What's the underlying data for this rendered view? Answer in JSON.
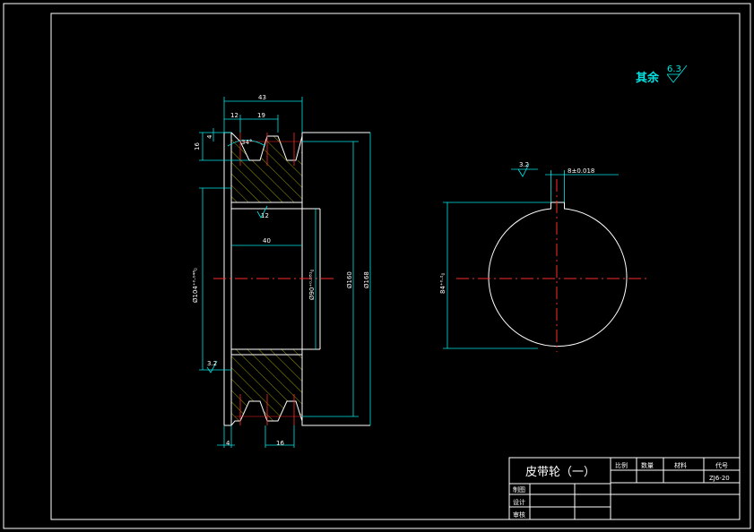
{
  "roughness": {
    "label": "其余",
    "value": "6.3"
  },
  "pulley_dims": {
    "width_43": "43",
    "pitch_12": "12",
    "pitch_19": "19",
    "groove_depth_16": "16",
    "groove_top_4": "4",
    "groove_angle": "34°",
    "bore_length_40": "40",
    "bore_dia": "Ø90⁺⁰·⁰⁸¹₀",
    "hub_dia": "Ø104⁺⁰·⁰⁴⁶₀",
    "outer_dia_160": "Ø160",
    "outer_dia_168": "Ø168",
    "bottom_4": "4",
    "bottom_16": "16",
    "surface_bore": "12",
    "surface_hub": "3.2"
  },
  "hub_dims": {
    "keyway_width": "8±0.018",
    "surface": "3.2",
    "depth": "84⁺⁰·²₀"
  },
  "title_block": {
    "title": "皮带轮（一）",
    "scale_label": "比例",
    "quantity_label": "数量",
    "material_label": "材料",
    "code_label": "代号",
    "drawing_no": "ZJ6-20",
    "draw_label": "制图",
    "design_label": "设计",
    "review_label": "审核"
  }
}
